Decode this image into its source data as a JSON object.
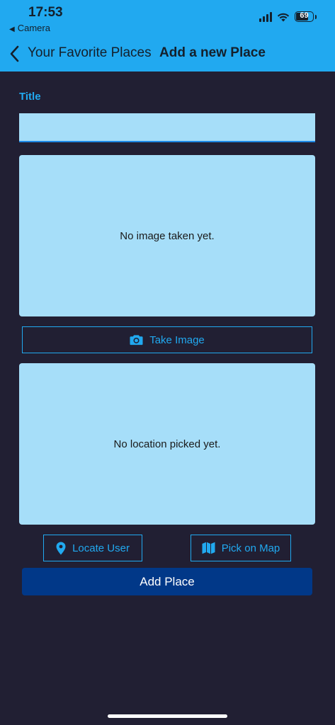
{
  "status_bar": {
    "time": "17:53",
    "back_app": "Camera",
    "battery": "69"
  },
  "nav": {
    "back_label": "Your Favorite Places",
    "title": "Add a new Place"
  },
  "form": {
    "title_label": "Title",
    "title_value": ""
  },
  "image_section": {
    "placeholder": "No image taken yet.",
    "button_label": "Take Image"
  },
  "location_section": {
    "placeholder": "No location picked yet.",
    "locate_label": "Locate User",
    "map_label": "Pick on Map"
  },
  "actions": {
    "add_label": "Add Place"
  },
  "colors": {
    "app_bar": "#21a9f0",
    "background": "#211f33",
    "panel": "#a6def9",
    "accent": "#21a9f0",
    "primary_button": "#013888"
  },
  "icons": {
    "nav_back": "chevron-left-icon",
    "take_image": "camera-icon",
    "locate_user": "location-pin-icon",
    "pick_on_map": "map-icon",
    "status": [
      "signal-icon",
      "wifi-icon",
      "battery-icon"
    ]
  }
}
